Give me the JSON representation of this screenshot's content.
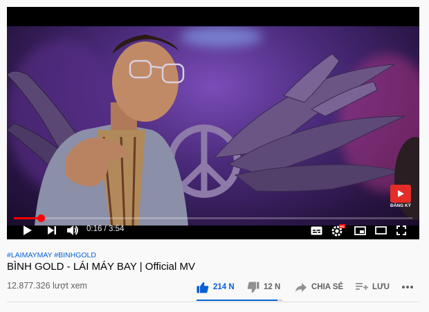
{
  "video": {
    "current_time": "0:16",
    "duration": "3:54",
    "time_separator": " / ",
    "progress_fraction": 0.068,
    "subscribe_label": "ĐĂNG KÝ"
  },
  "meta": {
    "hashtags": "#LAIMAYMAY #BINHGOLD",
    "title": "BÌNH GOLD - LÁI MÁY BAY | Official MV",
    "views": "12.877.326 lượt xem",
    "like_count": "214 N",
    "dislike_count": "12 N",
    "share_label": "CHIA SẺ",
    "save_label": "LƯU",
    "like_ratio": 0.947
  },
  "icons": {
    "play": "play-icon",
    "next": "next-icon",
    "volume": "volume-icon",
    "subtitles": "subtitles-icon",
    "settings": "settings-icon",
    "miniplayer": "miniplayer-icon",
    "theater": "theater-icon",
    "fullscreen": "fullscreen-icon"
  },
  "colors": {
    "accent_red": "#ff0000",
    "link_blue": "#065fd4",
    "hd_badge": "#ff0000"
  }
}
